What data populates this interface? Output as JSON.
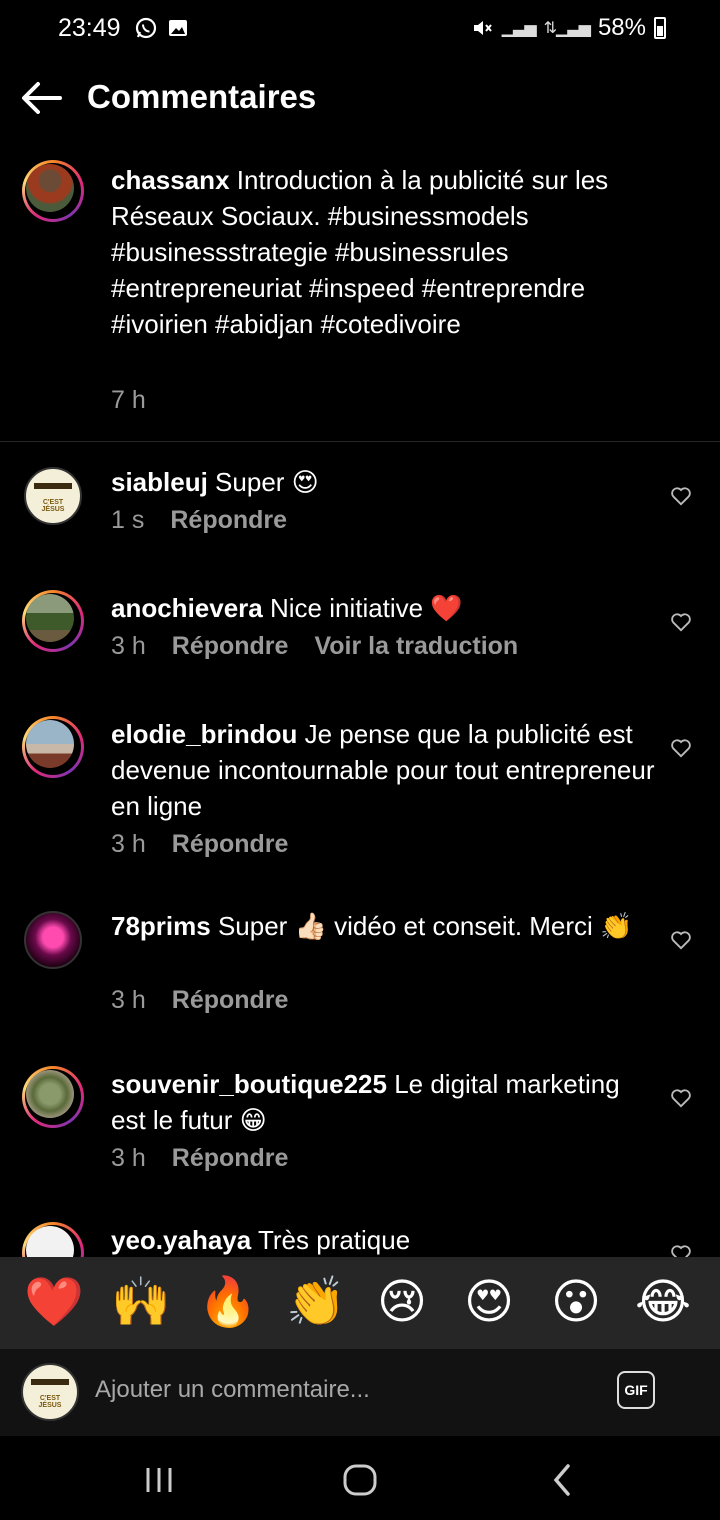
{
  "status": {
    "time": "23:49",
    "battery": "58%"
  },
  "header": {
    "title": "Commentaires"
  },
  "caption": {
    "username": "chassanx",
    "text": " Introduction à la publicité sur les Réseaux Sociaux. #businessmodels #businessstrategie #businessrules #entrepreneuriat #inspeed #entreprendre #ivoirien #abidjan #cotedivoire",
    "time": "7 h"
  },
  "comments": [
    {
      "username": "siableuj",
      "text": " Super 😍",
      "time": "1 s",
      "reply": "Répondre"
    },
    {
      "username": "anochievera",
      "text": " Nice initiative ❤️",
      "time": "3 h",
      "reply": "Répondre",
      "translate": "Voir la traduction"
    },
    {
      "username": "elodie_brindou",
      "text": " Je pense que la publicité est devenue incontournable pour tout entrepreneur en ligne",
      "time": "3 h",
      "reply": "Répondre"
    },
    {
      "username": "78prims",
      "text": " Super 👍🏻 vidéo et conseit. Merci 👏",
      "time": "3 h",
      "reply": "Répondre"
    },
    {
      "username": "souvenir_boutique225",
      "text": " Le digital marketing est le futur 😁",
      "time": "3 h",
      "reply": "Répondre"
    },
    {
      "username": "yeo.yahaya",
      "text": " Très pratique"
    }
  ],
  "emoji_bar": [
    "❤️",
    "🙌",
    "🔥",
    "👏",
    "😢",
    "😍",
    "😮",
    "😂"
  ],
  "input": {
    "placeholder": "Ajouter un commentaire...",
    "gif_label": "GIF"
  },
  "avatar_text": {
    "logo_line": "C'EST JÉSUS"
  },
  "colors": {
    "background": "#000000",
    "secondary_text": "#9a9a9a",
    "emoji_bar_bg": "#262626"
  }
}
